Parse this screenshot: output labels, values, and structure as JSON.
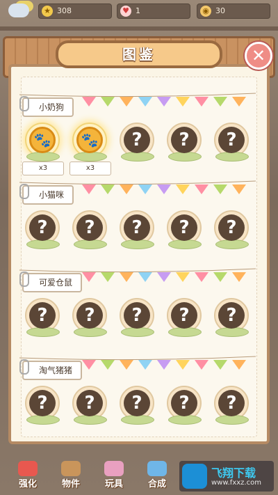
{
  "topbar": {
    "stars": "308",
    "hearts": "1",
    "coins": "30"
  },
  "panel": {
    "title": "图鉴",
    "close_label": "✕"
  },
  "sections": [
    {
      "name": "小奶狗",
      "slots": [
        {
          "unlocked": true,
          "count": "x3"
        },
        {
          "unlocked": true,
          "count": "x3"
        },
        {
          "unlocked": false
        },
        {
          "unlocked": false
        },
        {
          "unlocked": false
        }
      ]
    },
    {
      "name": "小猫咪",
      "slots": [
        {
          "unlocked": false
        },
        {
          "unlocked": false
        },
        {
          "unlocked": false
        },
        {
          "unlocked": false
        },
        {
          "unlocked": false
        }
      ]
    },
    {
      "name": "可爱仓鼠",
      "slots": [
        {
          "unlocked": false
        },
        {
          "unlocked": false
        },
        {
          "unlocked": false
        },
        {
          "unlocked": false
        },
        {
          "unlocked": false
        }
      ]
    },
    {
      "name": "淘气猪猪",
      "slots": [
        {
          "unlocked": false
        },
        {
          "unlocked": false
        },
        {
          "unlocked": false
        },
        {
          "unlocked": false
        },
        {
          "unlocked": false
        }
      ]
    }
  ],
  "locked_symbol": "?",
  "bottom_nav": [
    {
      "label": "强化",
      "icon": "target-icon",
      "color": "#e8584f"
    },
    {
      "label": "物件",
      "icon": "box-icon",
      "color": "#c9955b"
    },
    {
      "label": "玩具",
      "icon": "toy-icon",
      "color": "#e9a0c0"
    },
    {
      "label": "合成",
      "icon": "merge-icon",
      "color": "#6fb6e8"
    }
  ],
  "watermark": {
    "title": "飞翔下载",
    "url": "www.fxxz.com"
  },
  "colors": {
    "flags": [
      "#ff8fa3",
      "#b6d96b",
      "#ffb35c",
      "#8fd3f4",
      "#c79cf2",
      "#ffd45c"
    ]
  }
}
